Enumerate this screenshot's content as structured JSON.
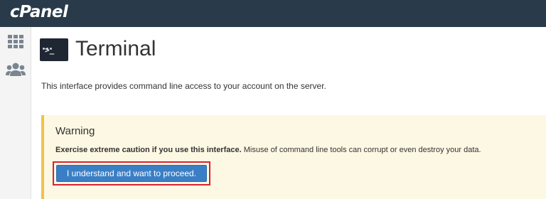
{
  "topbar": {
    "logo": "cPanel"
  },
  "sidebar": {
    "icons": [
      "apps-grid-icon",
      "users-icon"
    ]
  },
  "page": {
    "title": "Terminal",
    "title_icon": "terminal-icon",
    "title_icon_prompt": ">_",
    "description": "This interface provides command line access to your account on the server."
  },
  "warning": {
    "title": "Warning",
    "strong_text": "Exercise extreme caution if you use this interface.",
    "text": " Misuse of command line tools can corrupt or even destroy your data.",
    "button_label": "I understand and want to proceed."
  },
  "colors": {
    "topbar": "#293a4a",
    "warning_bg": "#fcf8e3",
    "warning_border": "#f0c24a",
    "button": "#3a7fc6",
    "highlight": "#d9232f"
  }
}
